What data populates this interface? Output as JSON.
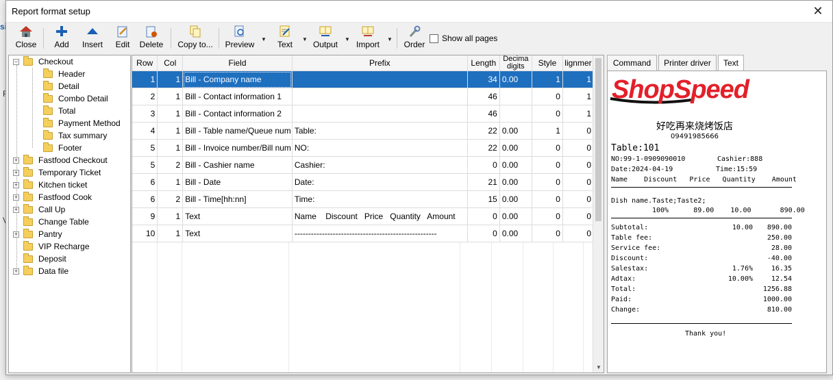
{
  "window": {
    "title": "Report format setup"
  },
  "backdrop": {
    "a": "si",
    "b": "F",
    "c": "V"
  },
  "toolbar": {
    "close": "Close",
    "add": "Add",
    "insert": "Insert",
    "edit": "Edit",
    "delete": "Delete",
    "copy_to": "Copy to...",
    "preview": "Preview",
    "text": "Text",
    "output": "Output",
    "import": "Import",
    "order": "Order",
    "show_all_pages": "Show all pages"
  },
  "tree": {
    "checkout": "Checkout",
    "checkout_children": [
      "Header",
      "Detail",
      "Combo Detail",
      "Total",
      "Payment Method",
      "Tax summary",
      "Footer"
    ],
    "roots": [
      "Fastfood Checkout",
      "Temporary Ticket",
      "Kitchen ticket",
      "Fastfood Cook",
      "Call Up",
      "Change Table",
      "Pantry",
      "VIP Recharge",
      "Deposit",
      "Data file"
    ]
  },
  "grid": {
    "headers": [
      "Row",
      "Col",
      "Field",
      "Prefix",
      "Length",
      "Decima digits",
      "Style",
      "lignmer"
    ],
    "rows": [
      [
        "1",
        "1",
        "Bill - Company name",
        "",
        "34",
        "0.00",
        "1",
        "1"
      ],
      [
        "2",
        "1",
        "Bill - Contact information 1",
        "",
        "46",
        "",
        "0",
        "1"
      ],
      [
        "3",
        "1",
        "Bill - Contact information 2",
        "",
        "46",
        "",
        "0",
        "1"
      ],
      [
        "4",
        "1",
        "Bill - Table name/Queue num",
        "Table:",
        "22",
        "0.00",
        "1",
        "0"
      ],
      [
        "5",
        "1",
        "Bill - Invoice number/Bill num",
        "NO:",
        "22",
        "0.00",
        "0",
        "0"
      ],
      [
        "5",
        "2",
        "Bill - Cashier name",
        "Cashier:",
        "0",
        "0.00",
        "0",
        "0"
      ],
      [
        "6",
        "1",
        "Bill - Date",
        "Date:",
        "21",
        "0.00",
        "0",
        "0"
      ],
      [
        "6",
        "2",
        "Bill - Time[hh:nn]",
        "Time:",
        "15",
        "0.00",
        "0",
        "0"
      ],
      [
        "9",
        "1",
        "Text",
        "Name    Discount   Price   Quantity   Amount",
        "0",
        "0.00",
        "0",
        "0"
      ],
      [
        "10",
        "1",
        "Text",
        "----------------------------------------------------",
        "0",
        "0.00",
        "0",
        "0"
      ]
    ]
  },
  "tabs": [
    "Command",
    "Printer driver",
    "Text"
  ],
  "receipt": {
    "logo_text": "ShopSpeed",
    "shop_name": "好吃再来烧烤饭店",
    "phone": "09491985666",
    "table": "Table:101",
    "no": "NO:99-1-0909090010",
    "cashier": "Cashier:888",
    "date": "Date:2024-04-19",
    "time": "Time:15:59",
    "header_line": "Name    Discount   Price   Quantity    Amount",
    "dish": "Dish name.Taste;Taste2;",
    "dish_line": "100%      89.00    10.00       890.00",
    "totals": [
      [
        "Subtotal:",
        "10.00",
        "890.00"
      ],
      [
        "Table fee:",
        "",
        "250.00"
      ],
      [
        "Service fee:",
        "",
        "28.00"
      ],
      [
        "Discount:",
        "",
        "-40.00"
      ],
      [
        "Salestax:",
        "1.76%",
        "16.35"
      ],
      [
        "Adtax:",
        "10.00%",
        "12.54"
      ],
      [
        "Total:",
        "",
        "1256.88"
      ],
      [
        "Paid:",
        "",
        "1000.00"
      ],
      [
        "Change:",
        "",
        "810.00"
      ]
    ],
    "thanks": "Thank you!"
  },
  "colors": {
    "selection": "#1f6fbf",
    "logo_red": "#e3202a",
    "folder": "#f5cf5c"
  }
}
